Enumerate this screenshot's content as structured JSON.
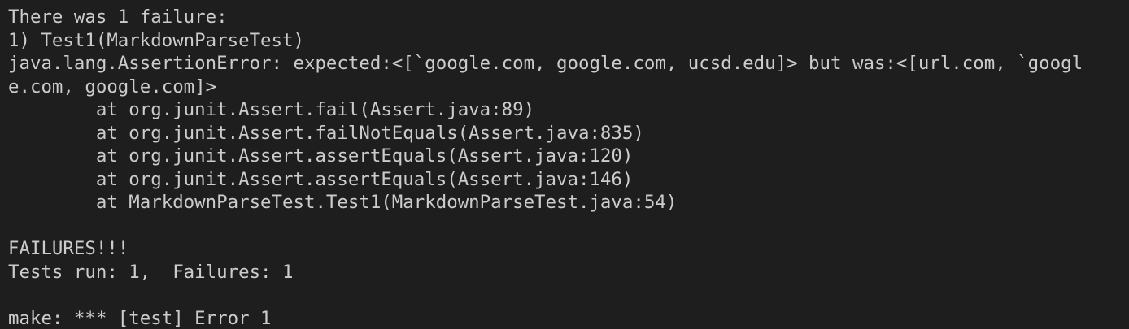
{
  "terminal": {
    "colors": {
      "background": "#1e1e1e",
      "foreground": "#cccccc"
    },
    "lines": [
      "There was 1 failure:",
      "1) Test1(MarkdownParseTest)",
      "java.lang.AssertionError: expected:<[`google.com, google.com, ucsd.edu]> but was:<[url.com, `googl",
      "e.com, google.com]>",
      "        at org.junit.Assert.fail(Assert.java:89)",
      "        at org.junit.Assert.failNotEquals(Assert.java:835)",
      "        at org.junit.Assert.assertEquals(Assert.java:120)",
      "        at org.junit.Assert.assertEquals(Assert.java:146)",
      "        at MarkdownParseTest.Test1(MarkdownParseTest.java:54)",
      "",
      "FAILURES!!!",
      "Tests run: 1,  Failures: 1",
      "",
      "make: *** [test] Error 1"
    ]
  }
}
